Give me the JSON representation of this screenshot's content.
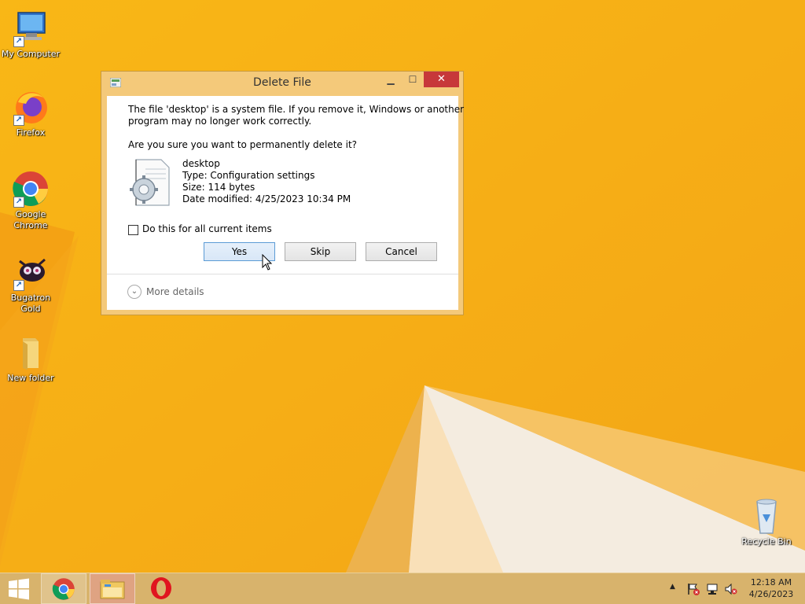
{
  "desktop": {
    "icons": [
      {
        "label": "My Computer",
        "icon": "computer-icon"
      },
      {
        "label": "Firefox",
        "icon": "firefox-icon"
      },
      {
        "label": "Google Chrome",
        "icon": "chrome-icon"
      },
      {
        "label": "Bugatron Gold",
        "icon": "bugatron-icon"
      },
      {
        "label": "New folder",
        "icon": "folder-icon"
      },
      {
        "label": "Recycle Bin",
        "icon": "recycle-bin-icon"
      }
    ]
  },
  "dialog": {
    "title": "Delete File",
    "warning_line1": "The file 'desktop' is a system file. If you remove it, Windows or another",
    "warning_line2": "program may no longer work correctly.",
    "question": "Are you sure you want to permanently delete it?",
    "file": {
      "name": "desktop",
      "type": "Type: Configuration settings",
      "size": "Size: 114 bytes",
      "modified": "Date modified: 4/25/2023 10:34 PM"
    },
    "checkbox_label": "Do this for all current items",
    "checkbox_checked": false,
    "buttons": {
      "yes": "Yes",
      "skip": "Skip",
      "cancel": "Cancel"
    },
    "more_details": "More details"
  },
  "taskbar": {
    "items": [
      "start-icon",
      "chrome-icon",
      "file-explorer-icon",
      "opera-icon"
    ],
    "tray_icons": [
      "show-hidden-icons-icon",
      "action-center-flag-icon",
      "network-icon",
      "volume-muted-icon"
    ],
    "time": "12:18 AM",
    "date": "4/26/2023"
  },
  "colors": {
    "wallpaper_primary": "#f7b21a",
    "dialog_frame": "#f4c97a",
    "close_button": "#c7383a",
    "taskbar": "#d8b36c"
  }
}
